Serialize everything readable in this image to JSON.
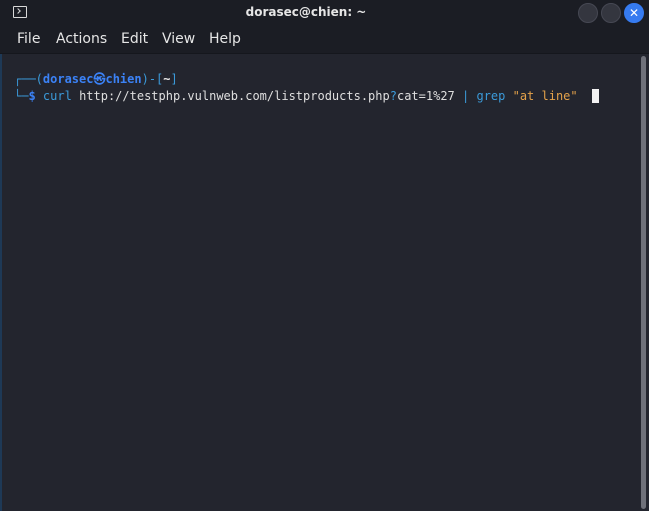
{
  "window": {
    "title": "dorasec@chien: ~",
    "controls": {
      "close_glyph": "✕"
    }
  },
  "menu": {
    "items": [
      "File",
      "Actions",
      "Edit",
      "View",
      "Help"
    ]
  },
  "terminal": {
    "prompt": {
      "frame_top": "┌──(",
      "user_host": "dorasec㉿chien",
      "mid": ")-[",
      "cwd": "~",
      "end": "]",
      "frame_bottom": "└─",
      "dollar": "$"
    },
    "command": {
      "program": "curl",
      "url_part1": "http://testphp.vulnweb.com/listproducts.php",
      "question_mark": "?",
      "url_part2": "cat=1%27",
      "pipe": "|",
      "grep": "grep",
      "pattern": "\"at line\""
    }
  },
  "colors": {
    "accent": "#367bf0",
    "prompt_blue": "#3b82f6",
    "string_orange": "#e4a24a",
    "background": "#23252e"
  }
}
